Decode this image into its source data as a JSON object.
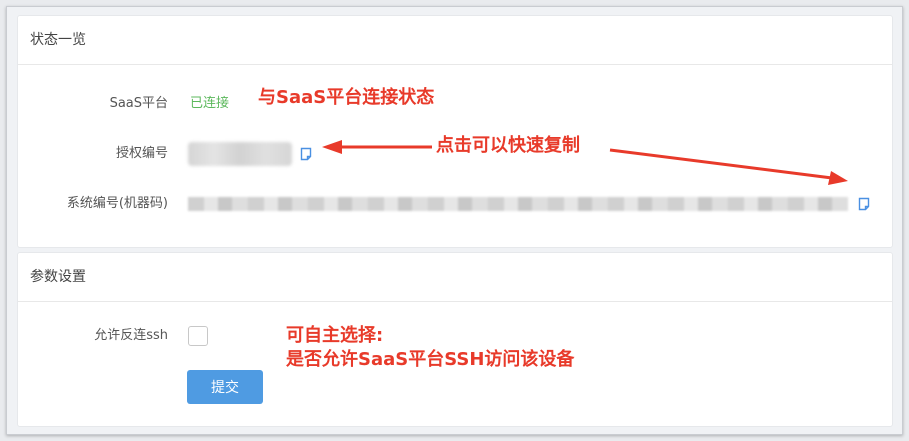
{
  "status_card": {
    "title": "状态一览",
    "rows": {
      "saas_label": "SaaS平台",
      "saas_value": "已连接",
      "auth_label": "授权编号",
      "system_label": "系统编号(机器码)"
    }
  },
  "params_card": {
    "title": "参数设置",
    "ssh_label": "允许反连ssh",
    "ssh_checked": false,
    "submit_label": "提交"
  },
  "annotations": {
    "saas_status": "与SaaS平台连接状态",
    "copy_hint": "点击可以快速复制",
    "ssh_line1": "可自主选择:",
    "ssh_line2": "是否允许SaaS平台SSH访问该设备"
  },
  "icons": {
    "copy": "copy-icon",
    "checkbox": "checkbox"
  },
  "colors": {
    "connected": "#5cb85c",
    "annotation": "#e83a2a",
    "primary_button": "#4f9be2",
    "link_icon": "#4a90e2"
  }
}
